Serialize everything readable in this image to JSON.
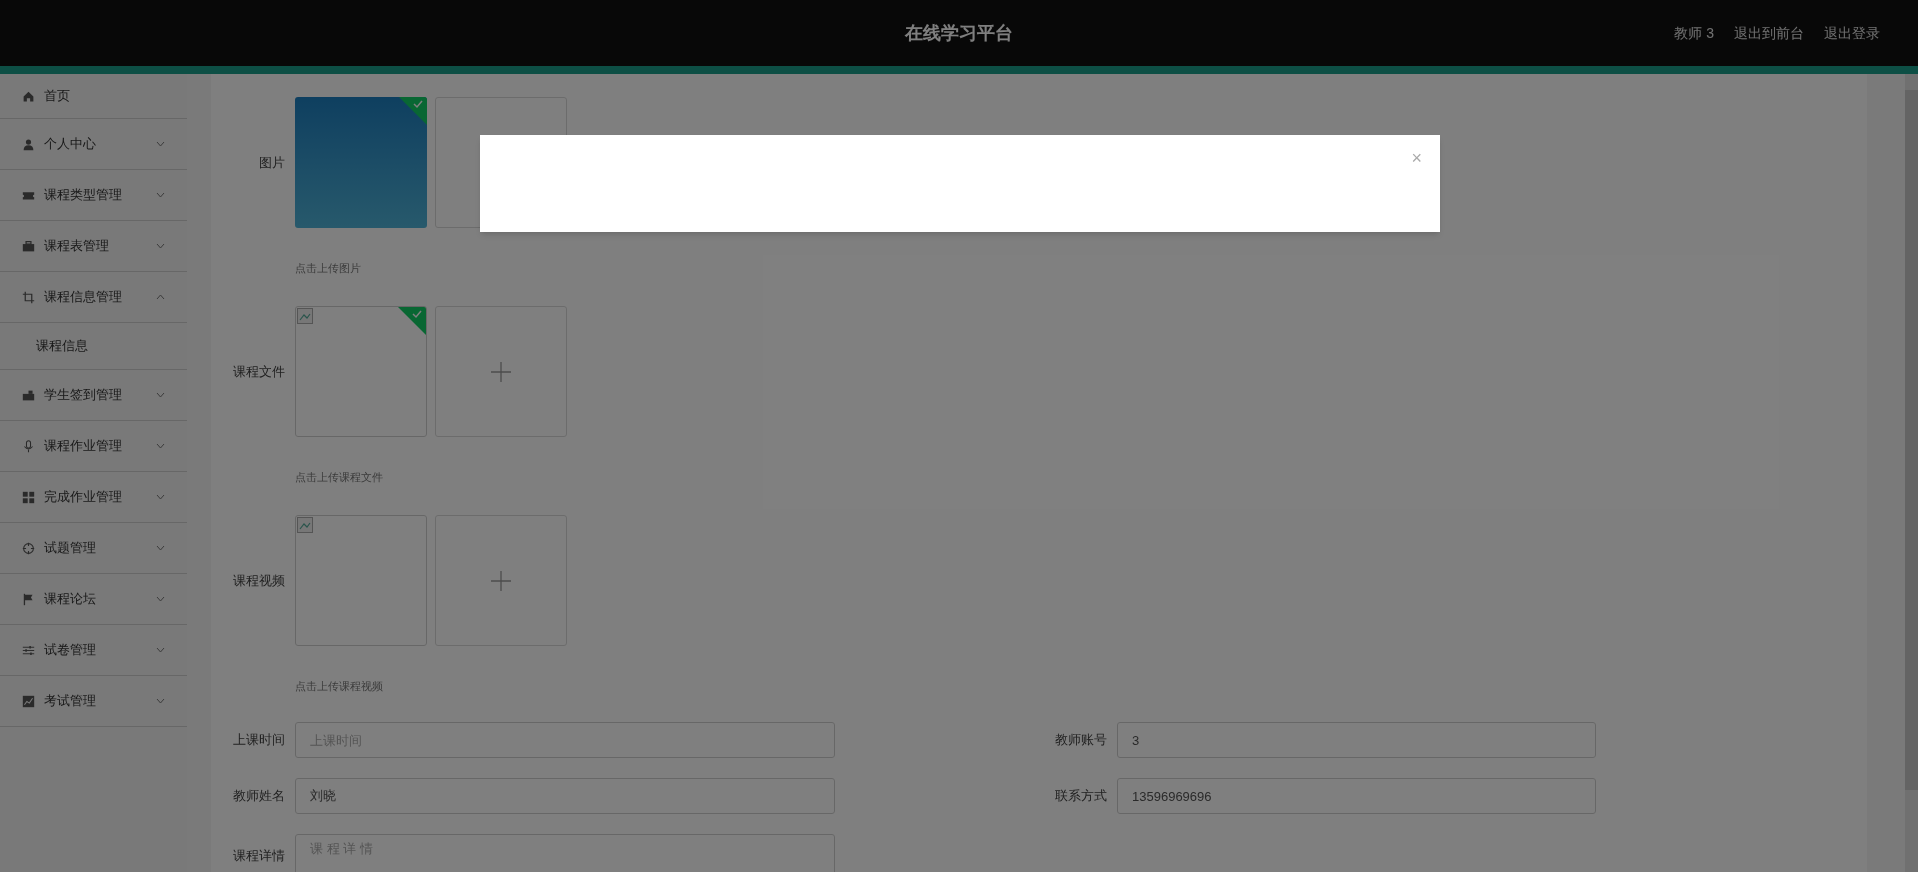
{
  "header": {
    "title": "在线学习平台",
    "links": [
      "教师 3",
      "退出到前台",
      "退出登录"
    ]
  },
  "sidebar": {
    "items": [
      {
        "label": "首页",
        "kind": "link"
      },
      {
        "label": "个人中心",
        "kind": "menu",
        "expanded": false
      },
      {
        "label": "课程类型管理",
        "kind": "menu",
        "expanded": false
      },
      {
        "label": "课程表管理",
        "kind": "menu",
        "expanded": false
      },
      {
        "label": "课程信息管理",
        "kind": "menu",
        "expanded": true,
        "children": [
          {
            "label": "课程信息"
          }
        ]
      },
      {
        "label": "学生签到管理",
        "kind": "menu",
        "expanded": false
      },
      {
        "label": "课程作业管理",
        "kind": "menu",
        "expanded": false
      },
      {
        "label": "完成作业管理",
        "kind": "menu",
        "expanded": false
      },
      {
        "label": "试题管理",
        "kind": "menu",
        "expanded": false
      },
      {
        "label": "课程论坛",
        "kind": "menu",
        "expanded": false
      },
      {
        "label": "试卷管理",
        "kind": "menu",
        "expanded": false
      },
      {
        "label": "考试管理",
        "kind": "menu",
        "expanded": false
      }
    ]
  },
  "form": {
    "uploads": [
      {
        "label": "图片",
        "kind": "photo",
        "uploaded": true,
        "hint": "点击上传图片"
      },
      {
        "label": "课程文件",
        "kind": "broken",
        "uploaded": true,
        "hint": "点击上传课程文件"
      },
      {
        "label": "课程视频",
        "kind": "broken",
        "uploaded": false,
        "hint": "点击上传课程视频"
      }
    ],
    "fields": [
      {
        "label": "上课时间",
        "placeholder": "上课时间"
      },
      {
        "label": "教师账号",
        "value": "3"
      },
      {
        "label": "教师姓名",
        "value": "刘晓"
      },
      {
        "label": "联系方式",
        "value": "13596969696"
      },
      {
        "label": "课程详情",
        "placeholder": "课 程 详 情",
        "kind": "textarea"
      }
    ]
  },
  "dialog": {
    "close": "×"
  }
}
